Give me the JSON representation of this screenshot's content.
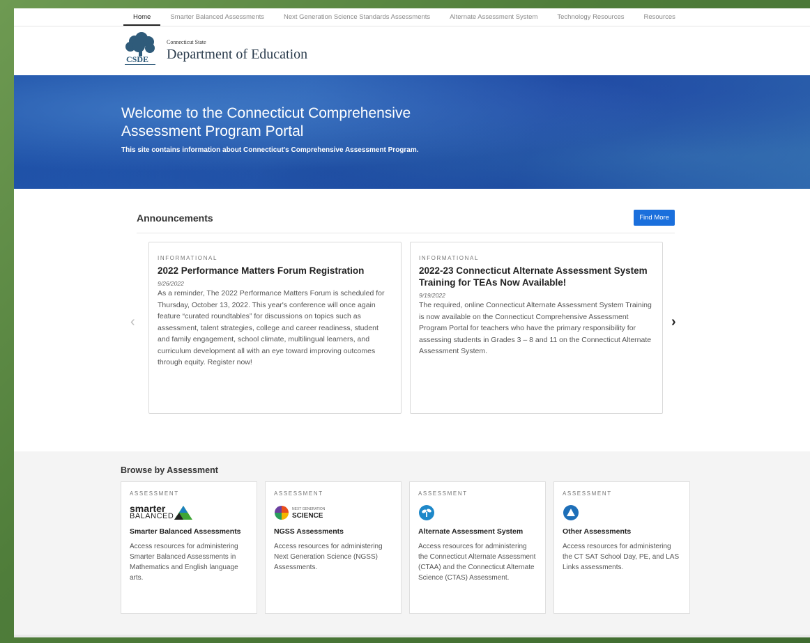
{
  "nav": {
    "items": [
      {
        "label": "Home",
        "active": true
      },
      {
        "label": "Smarter Balanced Assessments",
        "active": false
      },
      {
        "label": "Next Generation Science Standards Assessments",
        "active": false
      },
      {
        "label": "Alternate Assessment System",
        "active": false
      },
      {
        "label": "Technology Resources",
        "active": false
      },
      {
        "label": "Resources",
        "active": false
      }
    ]
  },
  "header": {
    "state": "Connecticut State",
    "department": "Department of Education",
    "logo_text": "CSDE"
  },
  "hero": {
    "title": "Welcome to the Connecticut Comprehensive Assessment Program Portal",
    "subtitle": "This site contains information about Connecticut's Comprehensive Assessment Program."
  },
  "announcements": {
    "heading": "Announcements",
    "find_more": "Find More",
    "prev_icon": "chevron-left-icon",
    "next_icon": "chevron-right-icon",
    "items": [
      {
        "category": "INFORMATIONAL",
        "title": "2022 Performance Matters Forum Registration",
        "date": "9/26/2022",
        "body": "As a reminder, The 2022 Performance Matters Forum is scheduled for Thursday, October 13, 2022. This year's conference will once again feature “curated roundtables” for discussions on topics such as assessment, talent strategies, college and career readiness, student and family engagement, school climate, multilingual learners, and curriculum development all with an eye toward improving outcomes through equity. Register now!"
      },
      {
        "category": "INFORMATIONAL",
        "title": "2022-23 Connecticut Alternate Assessment System Training for TEAs Now Available!",
        "date": "9/19/2022",
        "body": "The required, online Connecticut Alternate Assessment System Training is now available on the Connecticut Comprehensive Assessment Program Portal for teachers who have the primary responsibility for assessing students in Grades 3 – 8 and 11 on the Connecticut Alternate Assessment System."
      }
    ]
  },
  "browse": {
    "heading": "Browse by Assessment",
    "items": [
      {
        "category": "ASSESSMENT",
        "logo_top": "smarter",
        "logo_bottom": "BALANCED",
        "title": "Smarter Balanced Assessments",
        "desc": "Access resources for administering Smarter Balanced Assessments in Mathematics and English language arts."
      },
      {
        "category": "ASSESSMENT",
        "logo_top": "NEXT GENERATION",
        "logo_bottom": "SCIENCE",
        "title": "NGSS Assessments",
        "desc": "Access resources for administering Next Generation Science (NGSS) Assessments."
      },
      {
        "category": "ASSESSMENT",
        "title": "Alternate Assessment System",
        "desc": "Access resources for administering the Connecticut Alternate Assessment (CTAA) and the Connecticut Alternate Science (CTAS) Assessment."
      },
      {
        "category": "ASSESSMENT",
        "title": "Other Assessments",
        "desc": "Access resources for administering the CT SAT School Day, PE, and LAS Links assessments."
      }
    ]
  },
  "colors": {
    "accent": "#1a6fdc",
    "hero": "#1d4fa6",
    "frame": "#4f7d3a"
  }
}
